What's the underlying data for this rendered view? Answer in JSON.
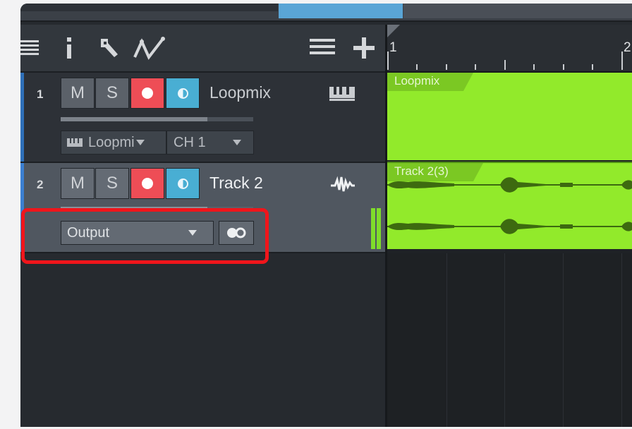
{
  "tracks": [
    {
      "number": "1",
      "name": "Loopmix",
      "mute_label": "M",
      "solo_label": "S",
      "input_label": "Loopmi",
      "channel_label": "CH 1",
      "type_icon": "piano-keys-icon",
      "volume_level": 0.76
    },
    {
      "number": "2",
      "name": "Track 2",
      "mute_label": "M",
      "solo_label": "S",
      "output_label": "Output",
      "type_icon": "audio-waveform-icon",
      "volume_level": 0.76
    }
  ],
  "ruler": {
    "bar_1": "1",
    "bar_2": "2"
  },
  "clips": [
    {
      "label": "Loopmix"
    },
    {
      "label": "Track 2(3)"
    }
  ],
  "colors": {
    "record": "#ee4d56",
    "monitor": "#49aed3",
    "clip": "#92ea2b",
    "highlight": "#f0151b",
    "selected_track": "#3b7fd1"
  },
  "highlight_target": "track-2-output-selector"
}
